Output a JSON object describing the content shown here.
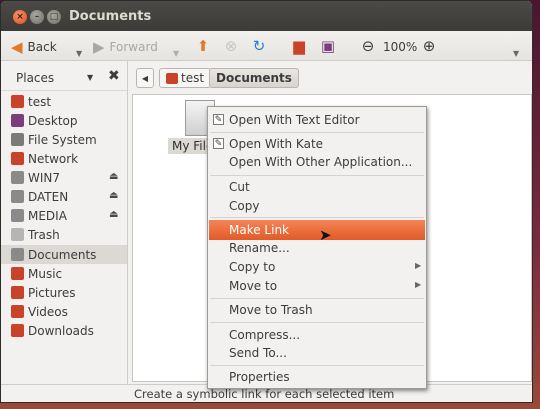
{
  "window": {
    "title": "Documents"
  },
  "titlebar_buttons": {
    "close": "×",
    "minimize": "–",
    "maximize": "□"
  },
  "toolbar": {
    "back_label": "Back",
    "forward_label": "Forward",
    "zoom_level": "100%",
    "zoom_out_glyph": "⊖",
    "zoom_in_glyph": "⊕"
  },
  "sidebar": {
    "header": "Places",
    "items": [
      {
        "label": "test",
        "color": "#c9432a"
      },
      {
        "label": "Desktop",
        "color": "#7a3f7a"
      },
      {
        "label": "File System",
        "color": "#7a7a7a"
      },
      {
        "label": "Network",
        "color": "#c9432a"
      },
      {
        "label": "WIN7",
        "color": "#8a8a8a"
      },
      {
        "label": "DATEN",
        "color": "#8a8a8a"
      },
      {
        "label": "MEDIA",
        "color": "#8a8a8a"
      },
      {
        "label": "Trash",
        "color": "#9a9a9a"
      },
      {
        "label": "Documents",
        "color": "#8a8a8a"
      },
      {
        "label": "Music",
        "color": "#c9432a"
      },
      {
        "label": "Pictures",
        "color": "#c9432a"
      },
      {
        "label": "Videos",
        "color": "#c9432a"
      },
      {
        "label": "Downloads",
        "color": "#c9432a"
      }
    ]
  },
  "pathbar": {
    "crumbs": [
      "test",
      "Documents"
    ]
  },
  "file": {
    "label": "My File"
  },
  "context_menu": {
    "open_text_editor": "Open With Text Editor",
    "open_kate": "Open With Kate",
    "open_other": "Open With Other Application...",
    "cut": "Cut",
    "copy": "Copy",
    "make_link": "Make Link",
    "rename": "Rename...",
    "copy_to": "Copy to",
    "move_to": "Move to",
    "move_trash": "Move to Trash",
    "compress": "Compress...",
    "send_to": "Send To...",
    "properties": "Properties"
  },
  "statusbar": {
    "text": "Create a symbolic link for each selected item"
  },
  "colors": {
    "accent": "#e25b28",
    "titlebar": "#3c3b37"
  }
}
